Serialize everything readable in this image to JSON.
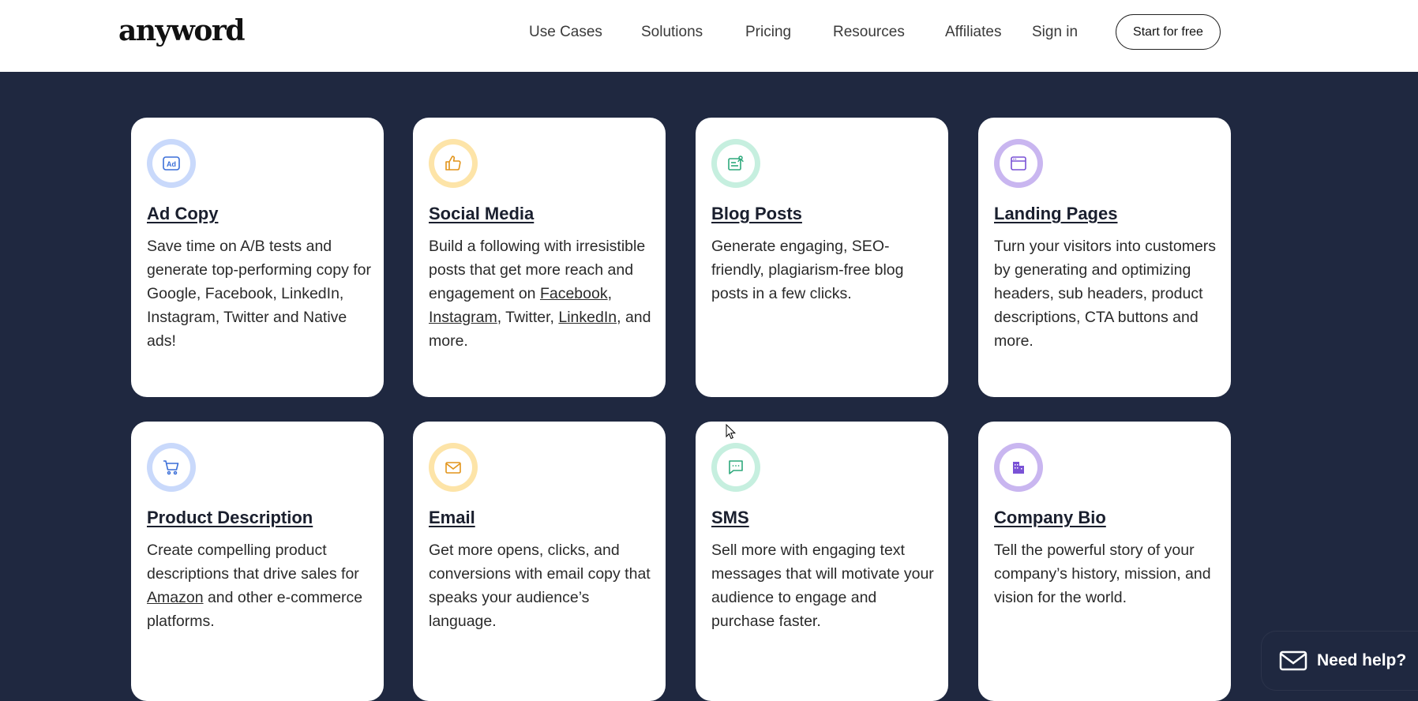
{
  "header": {
    "logo": "anyword",
    "nav": [
      "Use Cases",
      "Solutions",
      "Pricing",
      "Resources",
      "Affiliates",
      "Sign in"
    ],
    "cta": "Start for free"
  },
  "colors": {
    "page_bg": "#1f2840",
    "card_bg": "#ffffff",
    "ring_blue": "#c9d9fb",
    "ring_yellow": "#fde4a8",
    "ring_green": "#c6efdf",
    "ring_purple": "#c9b6f0"
  },
  "cards": [
    {
      "title": "Ad Copy",
      "icon": "ad-icon",
      "desc": "Save time on A/B tests and generate top-performing copy for Google, Facebook, LinkedIn, Instagram, Twitter and Native ads!"
    },
    {
      "title": "Social Media",
      "icon": "thumbs-up-icon",
      "desc_pre": "Build a following with irresistible posts that get more reach and engagement on ",
      "link1": "Facebook",
      "sep1": ", ",
      "link2": "Instagram",
      "sep2": ", Twitter, ",
      "link3": "LinkedIn",
      "desc_post": ", and more."
    },
    {
      "title": "Blog Posts",
      "icon": "blog-icon",
      "desc": "Generate engaging, SEO-friendly, plagiarism-free blog posts in a few clicks."
    },
    {
      "title": "Landing Pages",
      "icon": "browser-window-icon",
      "desc": "Turn your visitors into customers by generating and optimizing headers, sub headers, product descriptions, CTA buttons and more."
    },
    {
      "title": "Product Description",
      "icon": "shopping-cart-icon",
      "desc_pre": "Create compelling product descriptions that drive sales for ",
      "link1": "Amazon",
      "desc_post": " and other e-commerce platforms."
    },
    {
      "title": "Email",
      "icon": "envelope-icon",
      "desc": "Get more opens, clicks, and conversions with email copy that speaks your audience’s language."
    },
    {
      "title": "SMS",
      "icon": "chat-bubble-icon",
      "desc": "Sell more with engaging text messages that will motivate your audience to engage and purchase faster."
    },
    {
      "title": "Company Bio",
      "icon": "building-icon",
      "desc": "Tell the powerful story of your company’s history, mission, and vision for the world."
    }
  ],
  "help_widget": {
    "label": "Need help?",
    "icon": "envelope-icon"
  }
}
